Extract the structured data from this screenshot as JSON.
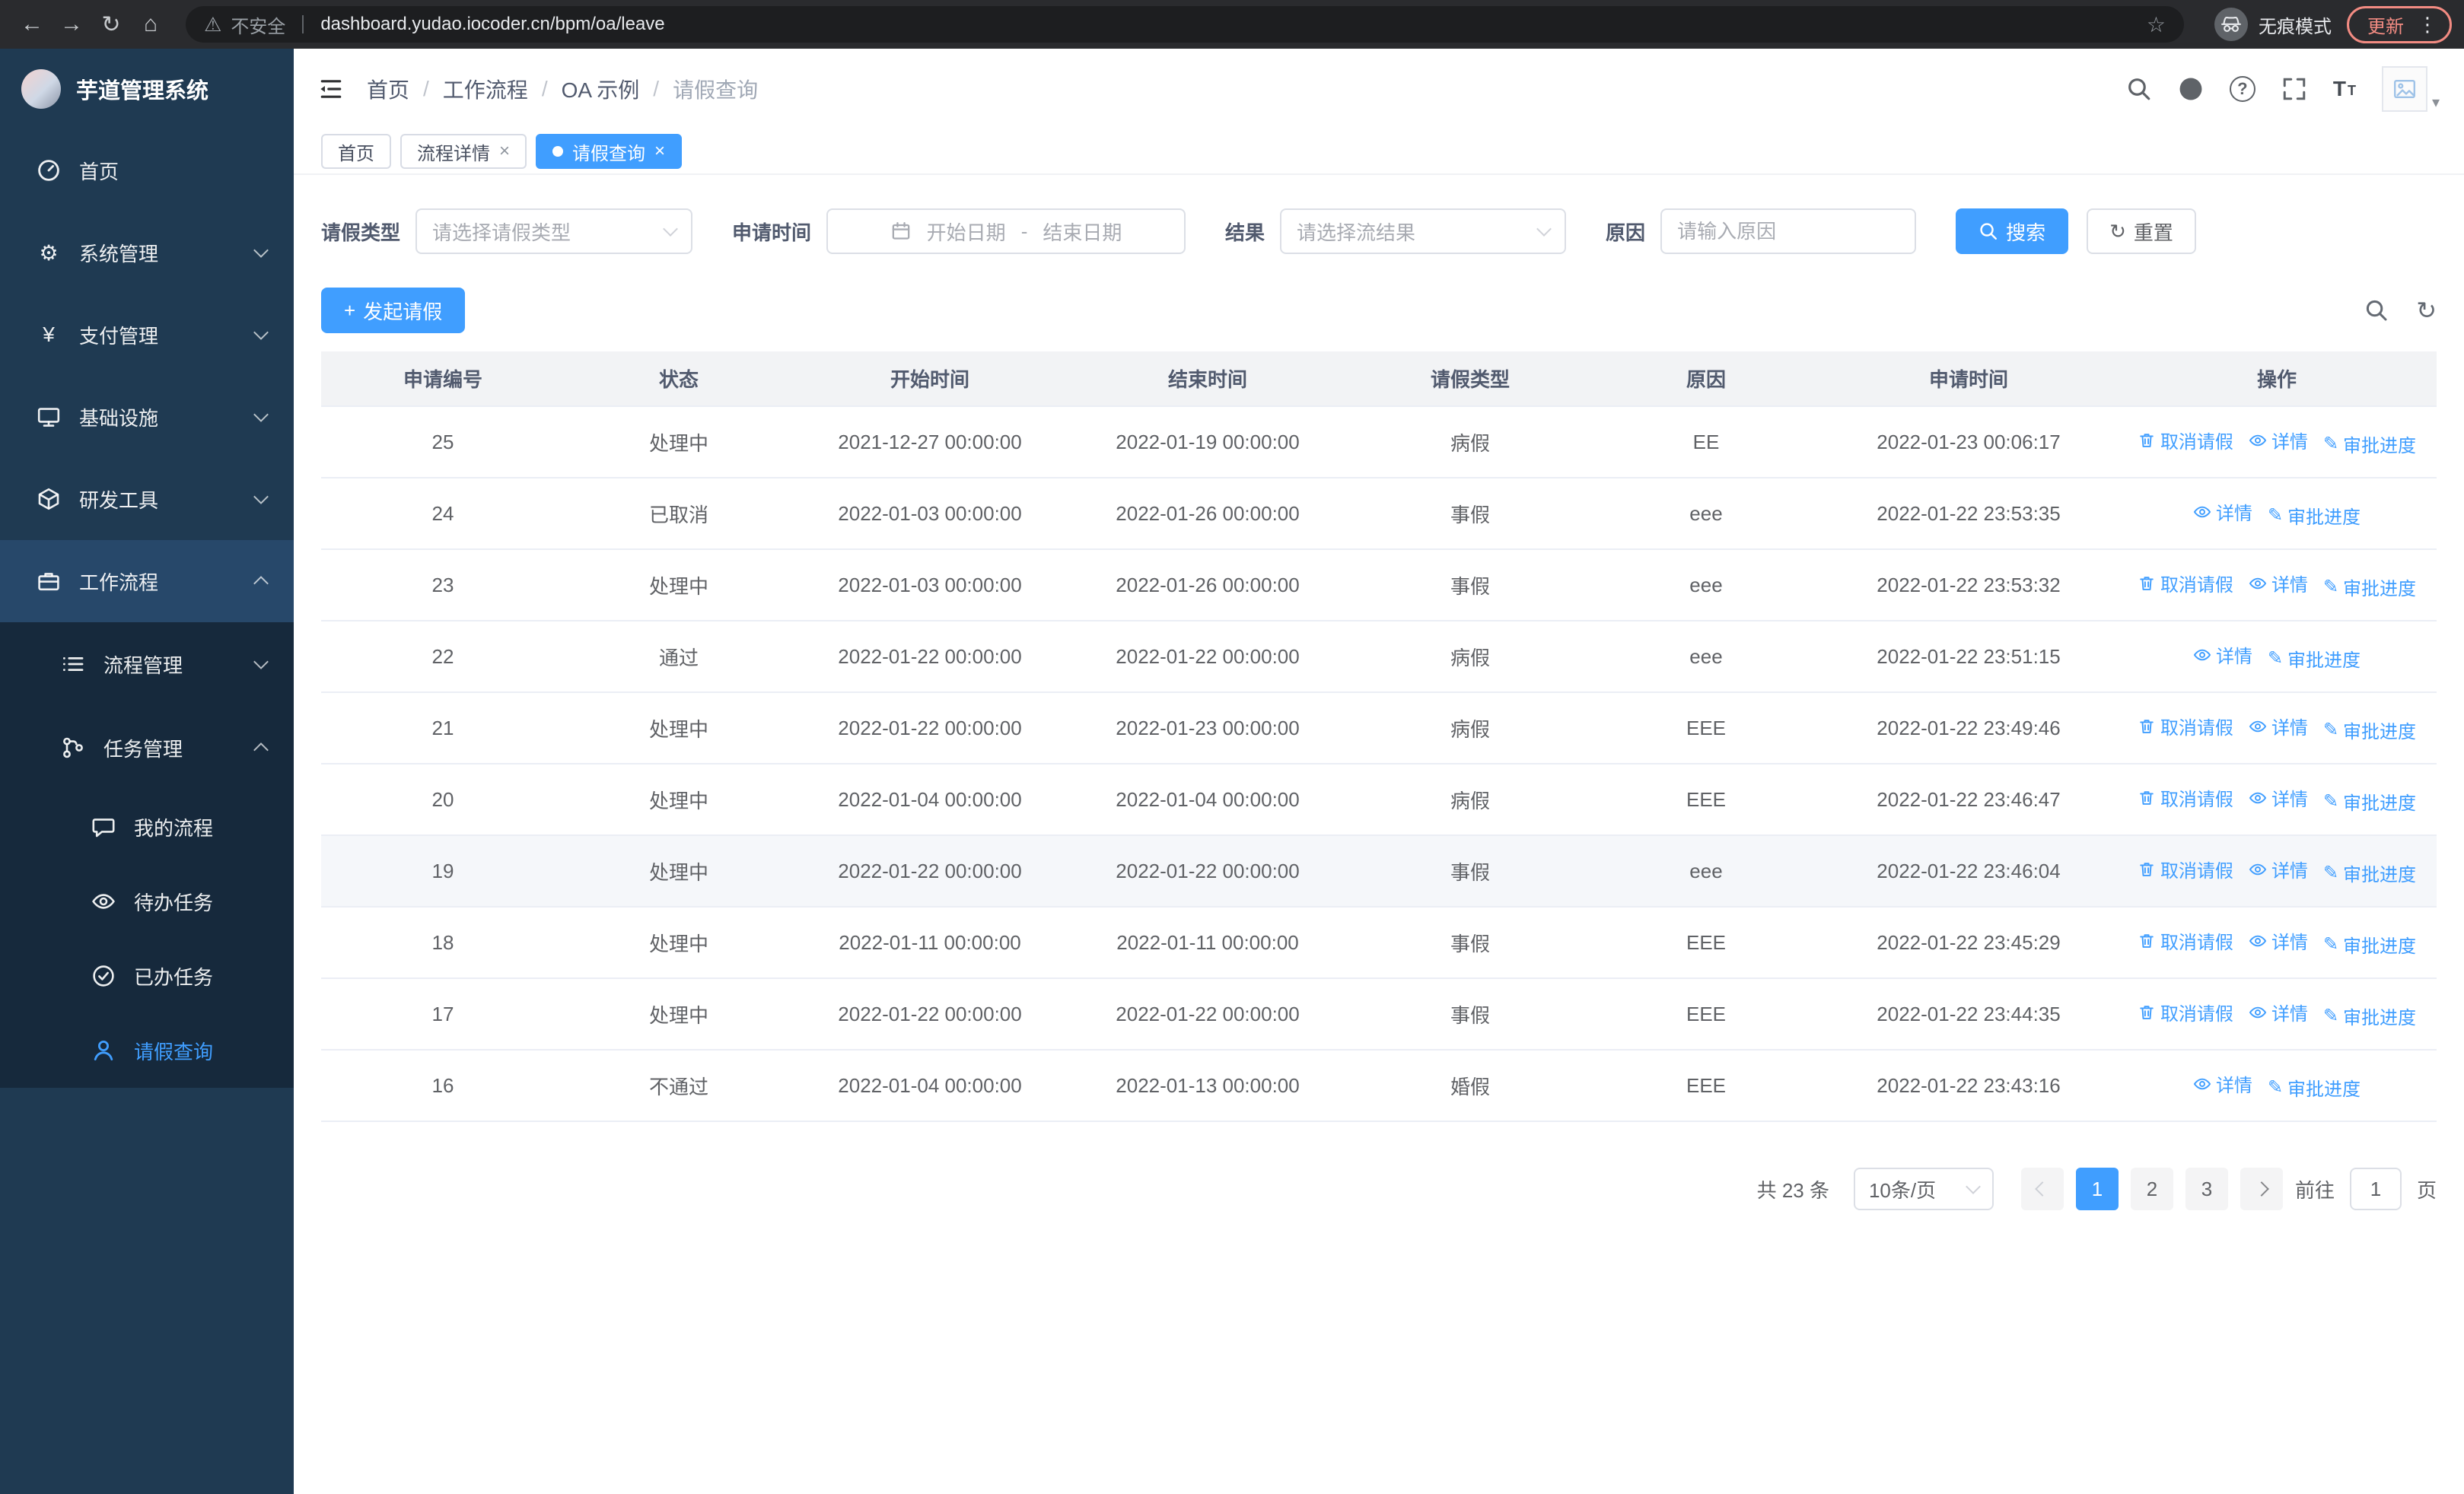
{
  "icons": {
    "back": "←",
    "forward": "→",
    "reload": "↻",
    "home": "⌂",
    "warning": "⚠",
    "star": "☆",
    "more": "⋮",
    "close": "×",
    "caret_down": "▾",
    "slash": "/",
    "plus": "+",
    "gear": "⚙",
    "yen": "¥",
    "edit": "✎",
    "refresh": "↻",
    "question": "?",
    "font_large": "T",
    "font_small": "T"
  },
  "colors": {
    "primary": "#409eff",
    "sidebar_bg": "#1f3a52",
    "submenu_bg": "#16293c",
    "update_accent": "#f28b82",
    "table_header_bg": "#f2f3f5"
  },
  "browser": {
    "security_label": "不安全",
    "url": "dashboard.yudao.iocoder.cn/bpm/oa/leave",
    "incognito_label": "无痕模式",
    "update_label": "更新"
  },
  "sidebar": {
    "logo_title": "芋道管理系统",
    "items": [
      {
        "label": "首页"
      },
      {
        "label": "系统管理"
      },
      {
        "label": "支付管理"
      },
      {
        "label": "基础设施"
      },
      {
        "label": "研发工具"
      },
      {
        "label": "工作流程",
        "children": [
          {
            "label": "流程管理"
          },
          {
            "label": "任务管理",
            "children": [
              {
                "label": "我的流程"
              },
              {
                "label": "待办任务"
              },
              {
                "label": "已办任务"
              },
              {
                "label": "请假查询"
              }
            ]
          }
        ]
      }
    ]
  },
  "header": {
    "breadcrumb": [
      "首页",
      "工作流程",
      "OA 示例",
      "请假查询"
    ]
  },
  "tabs": [
    {
      "label": "首页"
    },
    {
      "label": "流程详情"
    },
    {
      "label": "请假查询"
    }
  ],
  "filters": {
    "leave_type_label": "请假类型",
    "leave_type_placeholder": "请选择请假类型",
    "apply_time_label": "申请时间",
    "start_date_placeholder": "开始日期",
    "range_separator": "-",
    "end_date_placeholder": "结束日期",
    "result_label": "结果",
    "result_placeholder": "请选择流结果",
    "reason_label": "原因",
    "reason_placeholder": "请输入原因",
    "search_label": "搜索",
    "reset_label": "重置"
  },
  "toolbar": {
    "create_label": "发起请假"
  },
  "table": {
    "columns": [
      "申请编号",
      "状态",
      "开始时间",
      "结束时间",
      "请假类型",
      "原因",
      "申请时间",
      "操作"
    ],
    "rows": [
      {
        "id": "25",
        "status": "处理中",
        "start": "2021-12-27 00:00:00",
        "end": "2022-01-19 00:00:00",
        "type": "病假",
        "reason": "EE",
        "apply_time": "2022-01-23 00:06:17",
        "actions": [
          "取消请假",
          "详情",
          "审批进度"
        ]
      },
      {
        "id": "24",
        "status": "已取消",
        "start": "2022-01-03 00:00:00",
        "end": "2022-01-26 00:00:00",
        "type": "事假",
        "reason": "eee",
        "apply_time": "2022-01-22 23:53:35",
        "actions": [
          "详情",
          "审批进度"
        ]
      },
      {
        "id": "23",
        "status": "处理中",
        "start": "2022-01-03 00:00:00",
        "end": "2022-01-26 00:00:00",
        "type": "事假",
        "reason": "eee",
        "apply_time": "2022-01-22 23:53:32",
        "actions": [
          "取消请假",
          "详情",
          "审批进度"
        ]
      },
      {
        "id": "22",
        "status": "通过",
        "start": "2022-01-22 00:00:00",
        "end": "2022-01-22 00:00:00",
        "type": "病假",
        "reason": "eee",
        "apply_time": "2022-01-22 23:51:15",
        "actions": [
          "详情",
          "审批进度"
        ]
      },
      {
        "id": "21",
        "status": "处理中",
        "start": "2022-01-22 00:00:00",
        "end": "2022-01-23 00:00:00",
        "type": "病假",
        "reason": "EEE",
        "apply_time": "2022-01-22 23:49:46",
        "actions": [
          "取消请假",
          "详情",
          "审批进度"
        ]
      },
      {
        "id": "20",
        "status": "处理中",
        "start": "2022-01-04 00:00:00",
        "end": "2022-01-04 00:00:00",
        "type": "病假",
        "reason": "EEE",
        "apply_time": "2022-01-22 23:46:47",
        "actions": [
          "取消请假",
          "详情",
          "审批进度"
        ]
      },
      {
        "id": "19",
        "status": "处理中",
        "start": "2022-01-22 00:00:00",
        "end": "2022-01-22 00:00:00",
        "type": "事假",
        "reason": "eee",
        "apply_time": "2022-01-22 23:46:04",
        "actions": [
          "取消请假",
          "详情",
          "审批进度"
        ]
      },
      {
        "id": "18",
        "status": "处理中",
        "start": "2022-01-11 00:00:00",
        "end": "2022-01-11 00:00:00",
        "type": "事假",
        "reason": "EEE",
        "apply_time": "2022-01-22 23:45:29",
        "actions": [
          "取消请假",
          "详情",
          "审批进度"
        ]
      },
      {
        "id": "17",
        "status": "处理中",
        "start": "2022-01-22 00:00:00",
        "end": "2022-01-22 00:00:00",
        "type": "事假",
        "reason": "EEE",
        "apply_time": "2022-01-22 23:44:35",
        "actions": [
          "取消请假",
          "详情",
          "审批进度"
        ]
      },
      {
        "id": "16",
        "status": "不通过",
        "start": "2022-01-04 00:00:00",
        "end": "2022-01-13 00:00:00",
        "type": "婚假",
        "reason": "EEE",
        "apply_time": "2022-01-22 23:43:16",
        "actions": [
          "详情",
          "审批进度"
        ]
      }
    ]
  },
  "pagination": {
    "total_label": "共 23 条",
    "page_size": "10条/页",
    "pages": [
      "1",
      "2",
      "3"
    ],
    "active_page": "1",
    "goto_label": "前往",
    "goto_value": "1",
    "page_unit": "页"
  }
}
